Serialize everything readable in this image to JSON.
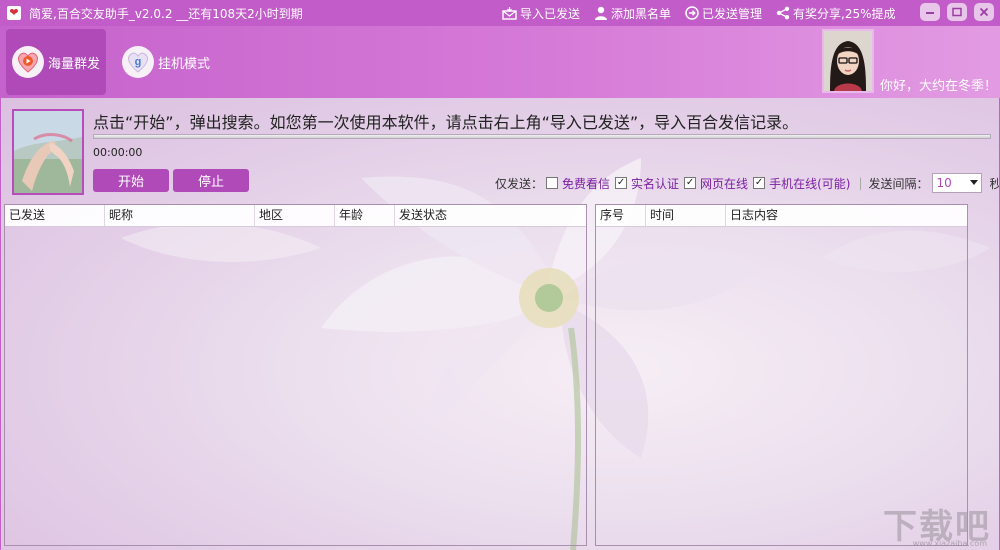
{
  "window": {
    "title": "简爱,百合交友助手_v2.0.2 __还有108天2小时到期",
    "actions": [
      {
        "label": "导入已发送",
        "icon": "mail-import-icon"
      },
      {
        "label": "添加黑名单",
        "icon": "user-block-icon"
      },
      {
        "label": "已发送管理",
        "icon": "arrow-circle-icon"
      },
      {
        "label": "有奖分享,25%提成",
        "icon": "share-icon"
      }
    ]
  },
  "header": {
    "modes": [
      {
        "label": "海量群发",
        "icon": "heart-play-icon",
        "active": true
      },
      {
        "label": "挂机模式",
        "icon": "heart-g-icon",
        "active": false
      }
    ],
    "greeting": "你好，大约在冬季！"
  },
  "main": {
    "notice": "点击“开始”，弹出搜索。如您第一次使用本软件，请点击右上角“导入已发送”，导入百合发信记录。",
    "timer": "00:00:00",
    "progress": 0,
    "start_label": "开始",
    "stop_label": "停止",
    "filter": {
      "label": "仅发送：",
      "options": [
        {
          "label": "免费看信",
          "checked": false
        },
        {
          "label": "实名认证",
          "checked": true
        },
        {
          "label": "网页在线",
          "checked": true
        },
        {
          "label": "手机在线(可能)",
          "checked": true
        }
      ],
      "interval_label": "发送间隔：",
      "interval_value": "10",
      "interval_unit": "秒"
    }
  },
  "sent_table": {
    "columns": [
      "已发送",
      "昵称",
      "地区",
      "年龄",
      "发送状态"
    ],
    "rows": []
  },
  "log_table": {
    "columns": [
      "序号",
      "时间",
      "日志内容"
    ],
    "rows": []
  },
  "watermark": {
    "text": "下载吧",
    "sub": "www.xiazaiba.com"
  },
  "colors": {
    "accent": "#b04ab9",
    "titlebar": "#c15cc8",
    "option_text": "#7a1fa0"
  }
}
